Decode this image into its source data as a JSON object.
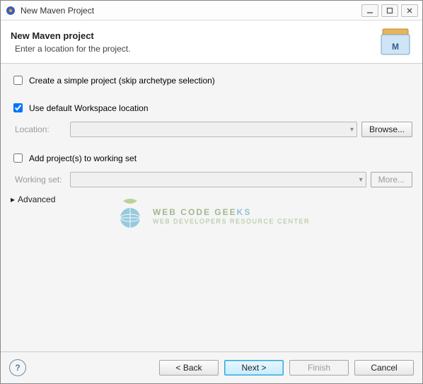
{
  "window": {
    "title": "New Maven Project"
  },
  "header": {
    "title": "New Maven project",
    "subtitle": "Enter a location for the project."
  },
  "form": {
    "simpleProject": {
      "label": "Create a simple project (skip archetype selection)",
      "checked": false
    },
    "useDefaultWorkspace": {
      "label": "Use default Workspace location",
      "checked": true
    },
    "locationLabel": "Location:",
    "locationValue": "",
    "browseLabel": "Browse...",
    "addToWorkingSet": {
      "label": "Add project(s) to working set",
      "checked": false
    },
    "workingSetLabel": "Working set:",
    "workingSetValue": "",
    "moreLabel": "More...",
    "advancedLabel": "Advanced"
  },
  "footer": {
    "back": "< Back",
    "next": "Next >",
    "finish": "Finish",
    "cancel": "Cancel"
  },
  "watermark": {
    "line1a": "WEB CODE GEE",
    "line1b": "KS",
    "line2": "WEB DEVELOPERS RESOURCE CENTER"
  }
}
